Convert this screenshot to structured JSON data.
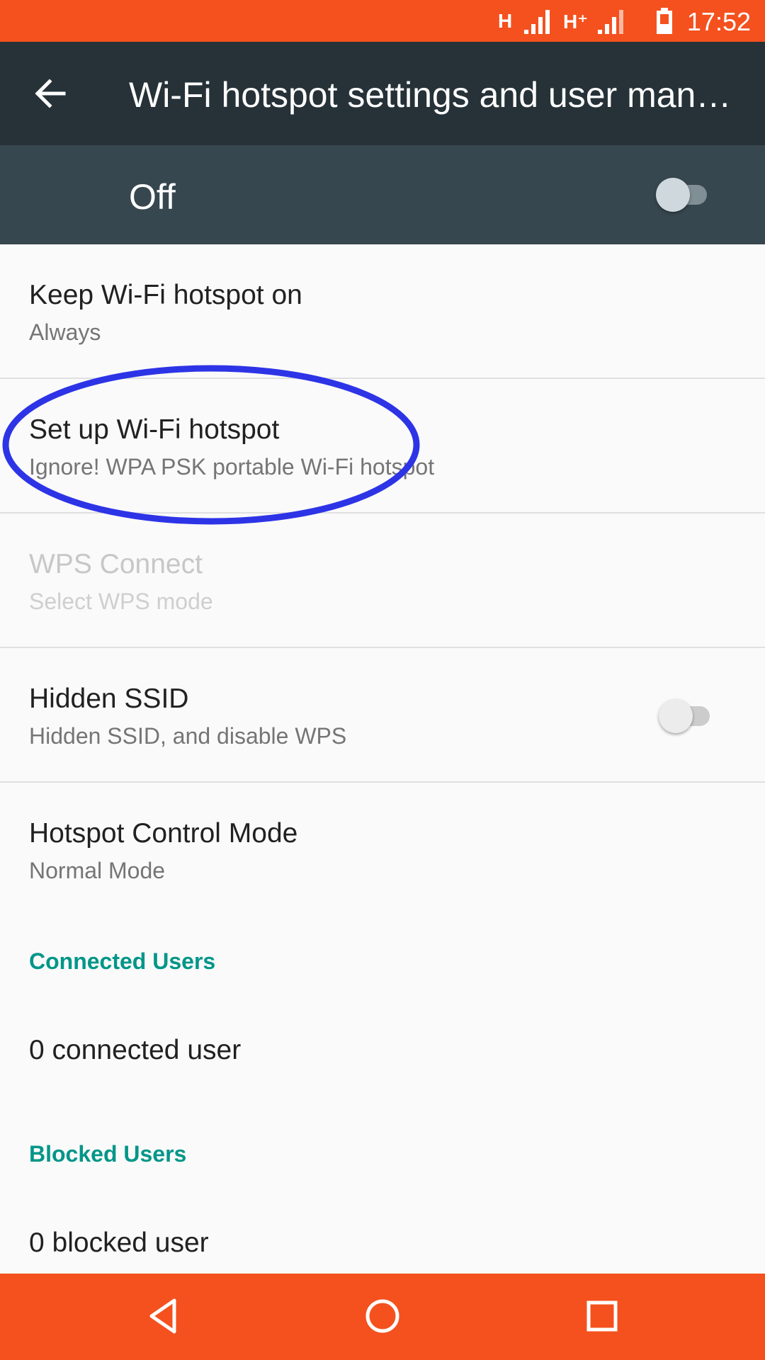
{
  "status_bar": {
    "network_1": "H",
    "network_2": "H⁺",
    "time": "17:52",
    "color": "#f4511e"
  },
  "app_bar": {
    "back_icon": "arrow-back-icon",
    "title": "Wi-Fi hotspot settings and user man…",
    "color": "#263238"
  },
  "master": {
    "label": "Off",
    "enabled": false
  },
  "prefs": [
    {
      "title": "Keep Wi-Fi hotspot on",
      "summary": "Always"
    },
    {
      "title": "Set up Wi-Fi hotspot",
      "summary": "Ignore! WPA PSK portable Wi-Fi hotspot"
    },
    {
      "title": "WPS Connect",
      "summary": "Select WPS mode",
      "disabled": true
    },
    {
      "title": "Hidden SSID",
      "summary": "Hidden SSID, and disable WPS",
      "switch_on": false
    },
    {
      "title": "Hotspot Control Mode",
      "summary": "Normal Mode"
    }
  ],
  "connected_users": {
    "header": "Connected Users",
    "value": "0 connected user"
  },
  "blocked_users": {
    "header": "Blocked Users",
    "value": "0 blocked user"
  },
  "accent_color": "#009688",
  "annotation_color": "#2d34e6",
  "nav_bar": {
    "icons": [
      "back-triangle-icon",
      "home-circle-icon",
      "recents-square-icon"
    ],
    "color": "#f4511e"
  }
}
